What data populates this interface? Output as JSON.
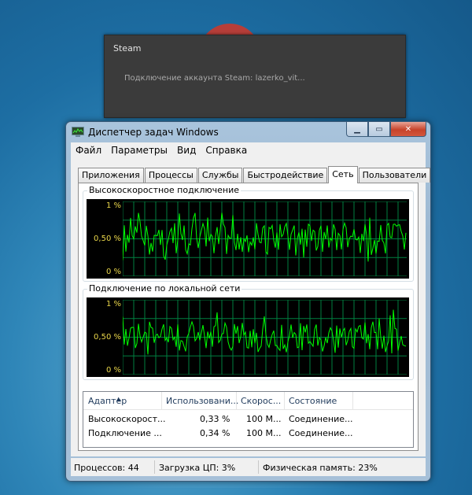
{
  "steam_popup": {
    "title": "Steam",
    "message": "Подключение аккаунта Steam: lazerko_vit..."
  },
  "window": {
    "title": "Диспетчер задач Windows",
    "controls": {
      "minimize": "▁",
      "maximize": "▭",
      "close": "✕"
    }
  },
  "menu": [
    "Файл",
    "Параметры",
    "Вид",
    "Справка"
  ],
  "tabs": [
    "Приложения",
    "Процессы",
    "Службы",
    "Быстродействие",
    "Сеть",
    "Пользователи"
  ],
  "active_tab": "Сеть",
  "graphs": [
    {
      "title": "Высокоскоростное подключение",
      "y_top": "1 %",
      "y_mid": "0,50 %",
      "y_bottom": "0 %"
    },
    {
      "title": "Подключение по локальной сети",
      "y_top": "1 %",
      "y_mid": "0,50 %",
      "y_bottom": "0 %"
    }
  ],
  "adapter_table": {
    "columns": [
      "Адаптер",
      "Использовани...",
      "Скорос...",
      "Состояние"
    ],
    "rows": [
      [
        "Высокоскорост...",
        "0,33 %",
        "100 М...",
        "Соединение..."
      ],
      [
        "Подключение ...",
        "0,34 %",
        "100 М...",
        "Соединение..."
      ]
    ]
  },
  "status_bar": {
    "processes": "Процессов: 44",
    "cpu": "Загрузка ЦП: 3%",
    "memory": "Физическая память: 23%"
  },
  "colors": {
    "graph_bg": "#000000",
    "graph_grid": "#008040",
    "graph_line": "#00ff00",
    "graph_labels": "#e9d64a"
  }
}
